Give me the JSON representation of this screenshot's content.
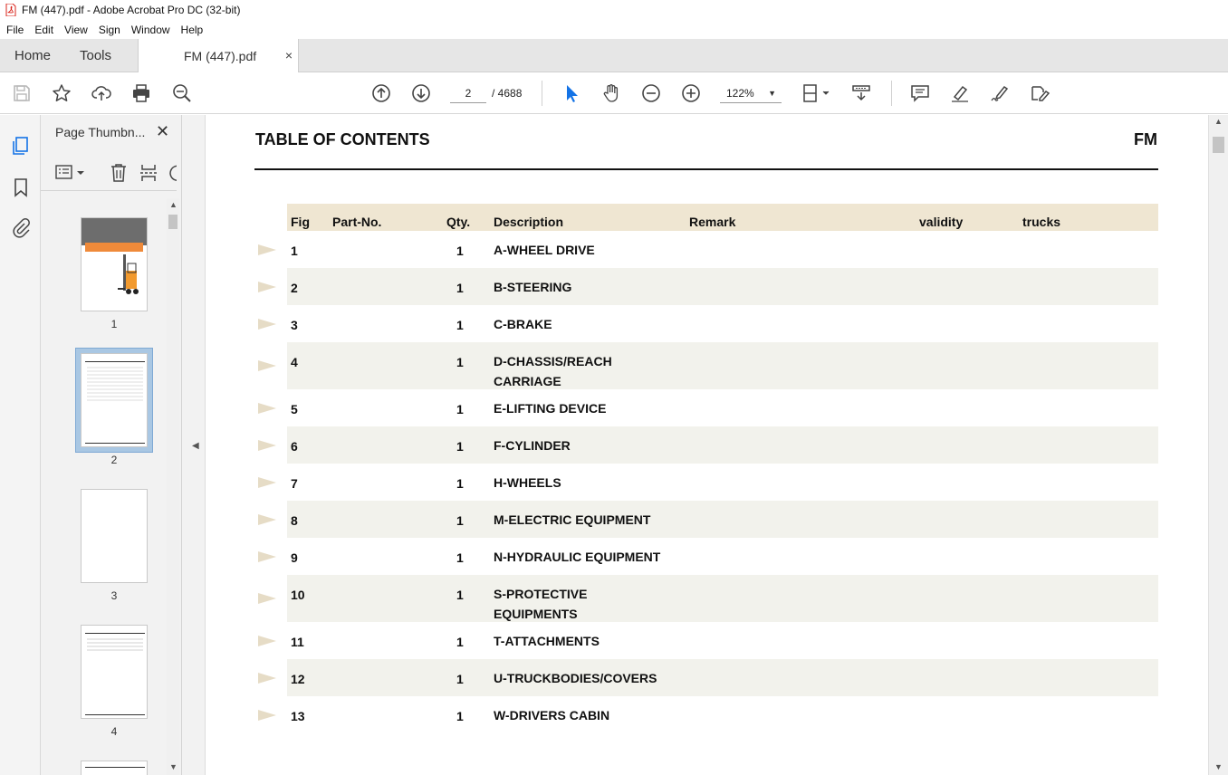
{
  "window": {
    "title": "FM (447).pdf - Adobe Acrobat Pro DC (32-bit)"
  },
  "menu": [
    "File",
    "Edit",
    "View",
    "Sign",
    "Window",
    "Help"
  ],
  "tabs": {
    "home": "Home",
    "tools": "Tools",
    "document": "FM (447).pdf",
    "close": "×"
  },
  "toolbar": {
    "current_page": "2",
    "page_total": "/  4688",
    "zoom": "122%",
    "icons": [
      "save-icon",
      "star-icon",
      "upload-icon",
      "print-icon",
      "search-zoom-icon",
      "arrow-up-icon",
      "arrow-down-icon",
      "select-cursor-icon",
      "hand-icon",
      "zoom-out-icon",
      "zoom-in-icon",
      "page-fit-icon",
      "scroll-mode-icon",
      "comment-icon",
      "highlight-icon",
      "sign-icon",
      "edit-icon"
    ]
  },
  "thumbnail_panel": {
    "title": "Page Thumbn...",
    "close": "✕",
    "pages": [
      "1",
      "2",
      "3",
      "4"
    ]
  },
  "document": {
    "title": "TABLE OF CONTENTS",
    "code": "FM",
    "headers": {
      "fig": "Fig",
      "part_no": "Part-No.",
      "qty": "Qty.",
      "description": "Description",
      "remark": "Remark",
      "validity": "validity",
      "trucks": "trucks"
    },
    "rows": [
      {
        "fig": "1",
        "qty": "1",
        "desc": "A-WHEEL DRIVE"
      },
      {
        "fig": "2",
        "qty": "1",
        "desc": "B-STEERING"
      },
      {
        "fig": "3",
        "qty": "1",
        "desc": "C-BRAKE"
      },
      {
        "fig": "4",
        "qty": "1",
        "desc": "D-CHASSIS/REACH",
        "desc2": "CARRIAGE"
      },
      {
        "fig": "5",
        "qty": "1",
        "desc": "E-LIFTING DEVICE"
      },
      {
        "fig": "6",
        "qty": "1",
        "desc": "F-CYLINDER"
      },
      {
        "fig": "7",
        "qty": "1",
        "desc": "H-WHEELS"
      },
      {
        "fig": "8",
        "qty": "1",
        "desc": "M-ELECTRIC EQUIPMENT"
      },
      {
        "fig": "9",
        "qty": "1",
        "desc": "N-HYDRAULIC EQUIPMENT"
      },
      {
        "fig": "10",
        "qty": "1",
        "desc": "S-PROTECTIVE",
        "desc2": "EQUIPMENTS"
      },
      {
        "fig": "11",
        "qty": "1",
        "desc": "T-ATTACHMENTS"
      },
      {
        "fig": "12",
        "qty": "1",
        "desc": "U-TRUCKBODIES/COVERS"
      },
      {
        "fig": "13",
        "qty": "1",
        "desc": "W-DRIVERS CABIN"
      }
    ]
  },
  "colors": {
    "header_bg": "#efe6d2",
    "row_shade": "#f2f2ec",
    "arrow": "#e6dcc6",
    "accent_blue": "#1473e6",
    "thumb_selected": "#a9c7e3"
  }
}
